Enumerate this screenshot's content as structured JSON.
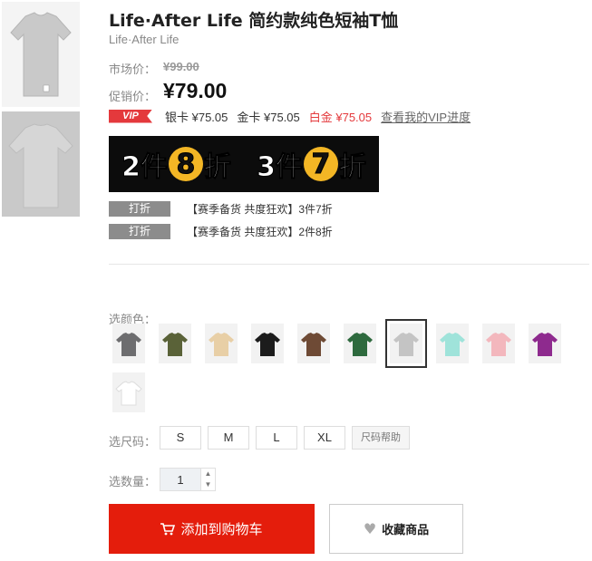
{
  "product": {
    "title": "Life·After Life 简约款纯色短袖T恤",
    "brand": "Life·After Life"
  },
  "price": {
    "market_label": "市场价：",
    "market_value": "¥99.00",
    "promo_label": "促销价：",
    "promo_value": "¥79.00"
  },
  "vip": {
    "badge": "VIP",
    "silver": "银卡 ¥75.05",
    "gold": "金卡 ¥75.05",
    "platinum": "白金 ¥75.05",
    "link": "查看我的VIP进度",
    "platinum_color": "#e4393c"
  },
  "banner": {
    "left_pre": "2件",
    "left_num": "8",
    "left_post": "折",
    "right_pre": "3件",
    "right_num": "7",
    "right_post": "折"
  },
  "discounts": [
    {
      "tag": "打折",
      "text": "【赛季备货 共度狂欢】3件7折"
    },
    {
      "tag": "打折",
      "text": "【赛季备货 共度狂欢】2件8折"
    }
  ],
  "colors": {
    "label": "选颜色：",
    "swatches": [
      {
        "name": "gray",
        "hex": "#6d6d6f"
      },
      {
        "name": "olive",
        "hex": "#5a6238"
      },
      {
        "name": "beige",
        "hex": "#e8cfa6"
      },
      {
        "name": "black",
        "hex": "#1c1c1c"
      },
      {
        "name": "brown",
        "hex": "#6e4a35"
      },
      {
        "name": "green",
        "hex": "#2e6a3e"
      },
      {
        "name": "light-gray",
        "hex": "#c4c4c4"
      },
      {
        "name": "mint",
        "hex": "#9fe3da"
      },
      {
        "name": "pink",
        "hex": "#f3b7bd"
      },
      {
        "name": "purple",
        "hex": "#8e2a8e"
      },
      {
        "name": "white",
        "hex": "#ffffff"
      }
    ],
    "selected_index": 6
  },
  "sizes": {
    "label": "选尺码：",
    "options": [
      "S",
      "M",
      "L",
      "XL"
    ],
    "help": "尺码帮助"
  },
  "quantity": {
    "label": "选数量：",
    "value": "1"
  },
  "actions": {
    "add_to_cart": "添加到购物车",
    "favorite": "收藏商品",
    "primary_color": "#e41d0c"
  }
}
